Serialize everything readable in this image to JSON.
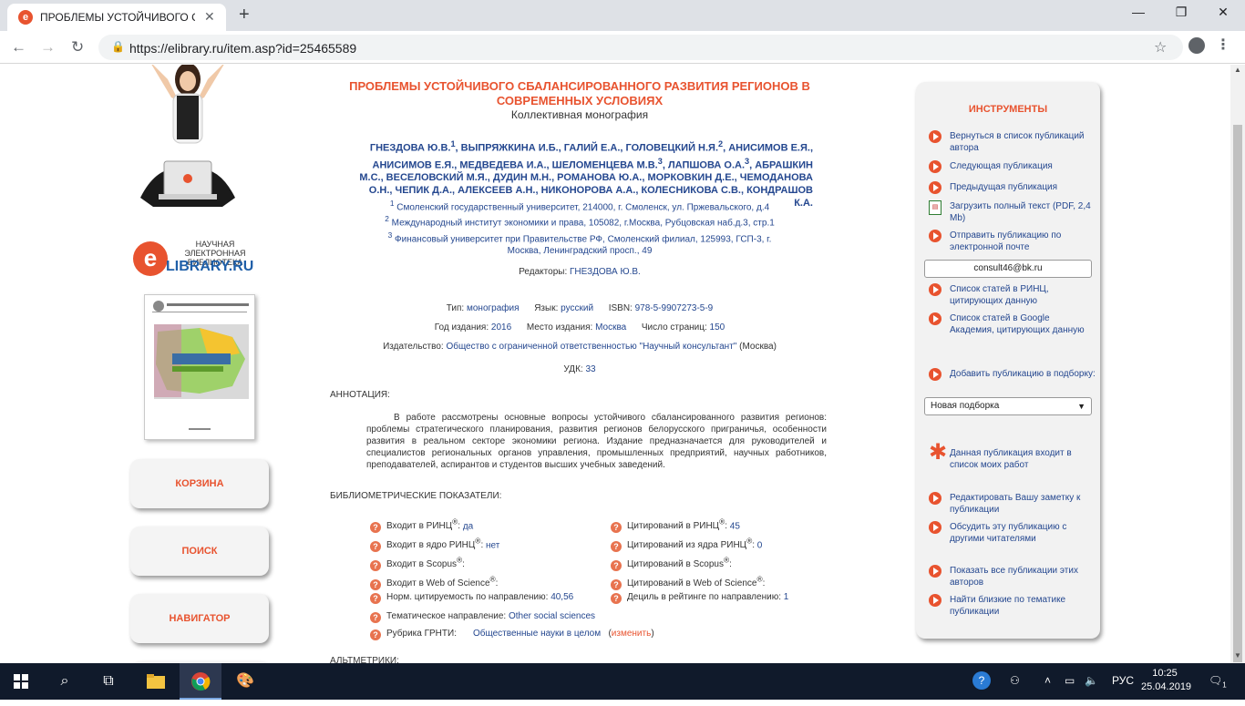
{
  "browser": {
    "tab_title": "ПРОБЛЕМЫ УСТОЙЧИВОГО СБ",
    "tab_favicon": "е",
    "url": "https://elibrary.ru/item.asp?id=25465589"
  },
  "site": {
    "logo_letter": "e",
    "logo_subtitle": "НАУЧНАЯ ЭЛЕКТРОННАЯ БИБЛИОТЕКА",
    "logo_text": "LIBRARY.RU",
    "nav_buttons": [
      "КОРЗИНА",
      "ПОИСК",
      "НАВИГАТОР"
    ]
  },
  "publication": {
    "title": "ПРОБЛЕМЫ УСТОЙЧИВОГО СБАЛАНСИРОВАННОГО РАЗВИТИЯ РЕГИОНОВ В СОВРЕМЕННЫХ УСЛОВИЯХ",
    "subtitle": "Коллективная монография",
    "authors_html": "ГНЕЗДОВА Ю.В.<sup>1</sup>, ВЫПРЯЖКИНА И.Б., ГАЛИЙ Е.А., ГОЛОВЕЦКИЙ Н.Я.<sup>2</sup>, АНИСИМОВ Е.Я., АНИСИМОВ Е.Я., МЕДВЕДЕВА И.А., ШЕЛОМЕНЦЕВА М.В.<sup>3</sup>, ЛАПШОВА О.А.<sup>3</sup>, АБРАШКИН М.С., ВЕСЕЛОВСКИЙ М.Я., ДУДИН М.Н., РОМАНОВА Ю.А., МОРКОВКИН Д.Е., ЧЕМОДАНОВА О.Н., ЧЕПИК Д.А., АЛЕКСЕЕВ А.Н., НИКОНОРОВА А.А., КОЛЕСНИКОВА С.В., КОНДРАШОВ К.А.",
    "affiliations": [
      {
        "num": "1",
        "text": "Смоленский государственный университет, 214000, г. Смоленск, ул. Пржевальского, д.4"
      },
      {
        "num": "2",
        "text": "Международный институт экономики и права, 105082, г.Москва, Рубцовская наб.д.3, стр.1"
      },
      {
        "num": "3",
        "text": "Финансовый университет при Правительстве РФ, Смоленский филиал, 125993, ГСП-3, г. Москва, Ленинградский просп., 49"
      }
    ],
    "editors_label": "Редакторы:",
    "editors_value": "ГНЕЗДОВА Ю.В.",
    "type_label": "Тип:",
    "type_value": "монография",
    "lang_label": "Язык:",
    "lang_value": "русский",
    "isbn_label": "ISBN:",
    "isbn_value": "978-5-9907273-5-9",
    "year_label": "Год издания:",
    "year_value": "2016",
    "place_label": "Место издания:",
    "place_value": "Москва",
    "pages_label": "Число страниц:",
    "pages_value": "150",
    "publisher_label": "Издательство:",
    "publisher_value": "Общество с ограниченной ответственностью \"Научный консультант\"",
    "publisher_city": "(Москва)",
    "udk_label": "УДК:",
    "udk_value": "33",
    "annotation_head": "АННОТАЦИЯ:",
    "annotation": "В работе рассмотрены основные вопросы устойчивого сбалансированного развития регионов: проблемы стратегического планирования, развития регионов белорусского приграничья, особенности развития в реальном секторе экономики региона. Издание предназначается для руководителей и специалистов региональных органов управления, промышленных предприятий, научных работников, преподавателей, аспирантов и студентов высших учебных заведений.",
    "biblio_head": "БИБЛИОМЕТРИЧЕСКИЕ ПОКАЗАТЕЛИ:",
    "altmetrics_head": "АЛЬТМЕТРИКИ:"
  },
  "metrics_left": [
    {
      "label": "Входит в РИНЦ<sup>®</sup>:",
      "value": "да"
    },
    {
      "label": "Входит в ядро РИНЦ<sup>®</sup>:",
      "value": "нет"
    },
    {
      "label": "Входит в Scopus<sup>®</sup>:",
      "value": ""
    },
    {
      "label": "Входит в Web of Science<sup>®</sup>:",
      "value": ""
    },
    {
      "label": "Норм. цитируемость по направлению:",
      "value": "40,56"
    }
  ],
  "metrics_right": [
    {
      "label": "Цитирований в РИНЦ<sup>®</sup>:",
      "value": "45"
    },
    {
      "label": "Цитирований из ядра РИНЦ<sup>®</sup>:",
      "value": "0"
    },
    {
      "label": "Цитирований в Scopus<sup>®</sup>:",
      "value": ""
    },
    {
      "label": "Цитирований в Web of Science<sup>®</sup>:",
      "value": ""
    },
    {
      "label": "Дециль в рейтинге по направлению:",
      "value": "1"
    }
  ],
  "metrics_extra": {
    "topic_label": "Тематическое направление:",
    "topic_value": "Other social sciences",
    "grnti_label": "Рубрика ГРНТИ:",
    "grnti_value": "Общественные науки в целом",
    "grnti_change": "изменить"
  },
  "tools": {
    "title": "ИНСТРУМЕНТЫ",
    "items": [
      "Вернуться в список публикаций автора",
      "Следующая публикация",
      "Предыдущая публикация",
      "Загрузить полный текст (PDF, 2,4 Mb)",
      "Отправить публикацию по электронной почте",
      "Список статей в РИНЦ, цитирующих данную",
      "Список статей в Google Академия, цитирующих данную",
      "Добавить публикацию в подборку:",
      "Данная публикация входит в список моих работ",
      "Редактировать Вашу заметку к публикации",
      "Обсудить эту публикацию с другими читателями",
      "Показать все публикации этих авторов",
      "Найти близкие по тематике публикации"
    ],
    "email": "consult46@bk.ru",
    "collection_select": "Новая подборка"
  },
  "taskbar": {
    "lang": "РУС",
    "time": "10:25",
    "date": "25.04.2019",
    "notif_count": "1"
  }
}
